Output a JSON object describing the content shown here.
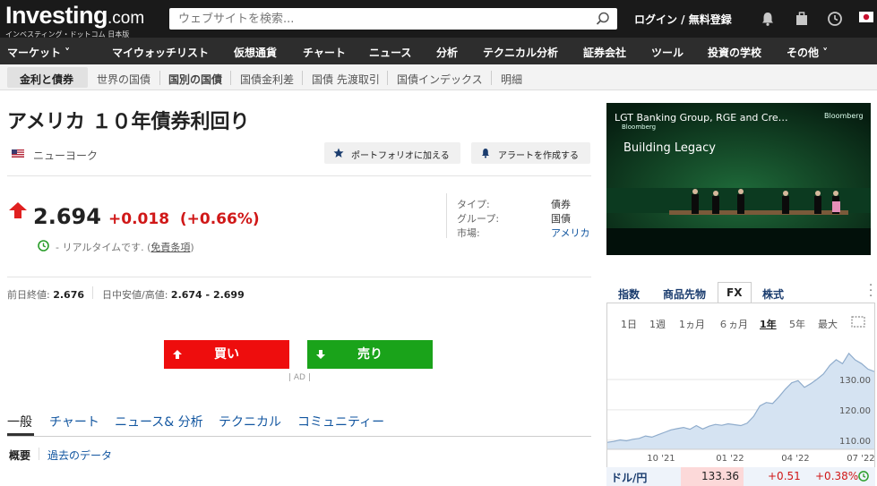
{
  "header": {
    "logo_main": "Investing",
    "logo_domain": ".com",
    "logo_sub": "インベスティング・ドットコム 日本版",
    "search_placeholder": "ウェブサイトを検索...",
    "login": "ログイン / 無料登録"
  },
  "nav": [
    {
      "label": "マーケット ˅"
    },
    {
      "label": "マイウォッチリスト"
    },
    {
      "label": "仮想通貨"
    },
    {
      "label": "チャート"
    },
    {
      "label": "ニュース"
    },
    {
      "label": "分析"
    },
    {
      "label": "テクニカル分析"
    },
    {
      "label": "証券会社"
    },
    {
      "label": "ツール"
    },
    {
      "label": "投資の学校"
    },
    {
      "label": "その他 ˅"
    }
  ],
  "subnav": [
    {
      "label": "金利と債券"
    },
    {
      "label": "世界の国債"
    },
    {
      "label": "国別の国債"
    },
    {
      "label": "国債金利差"
    },
    {
      "label": "国債 先渡取引"
    },
    {
      "label": "国債インデックス"
    },
    {
      "label": "明細"
    }
  ],
  "instrument": {
    "title": "アメリカ １０年債券利回り",
    "location": "ニューヨーク",
    "portfolio_btn": "ポートフォリオに加える",
    "alert_btn": "アラートを作成する",
    "price": "2.694",
    "change": "+0.018",
    "change_pct": "(+0.66%)",
    "realtime_text": "- リアルタイムです. (",
    "realtime_link": "免責条項",
    "realtime_end": ")",
    "info": [
      {
        "label": "タイプ:",
        "value": "債券"
      },
      {
        "label": "グループ:",
        "value": "国債"
      },
      {
        "label": "市場:",
        "value": "アメリカ"
      }
    ],
    "prev_close_label": "前日終値:",
    "prev_close": "2.676",
    "day_range_label": "日中安値/高値:",
    "day_range": "2.674 - 2.699",
    "buy": "買い",
    "sell": "売り",
    "ad": "| AD |"
  },
  "tabs": [
    {
      "label": "一般"
    },
    {
      "label": "チャート"
    },
    {
      "label": "ニュース& 分析"
    },
    {
      "label": "テクニカル"
    },
    {
      "label": "コミュニティー"
    }
  ],
  "subtabs": [
    {
      "label": "概要"
    },
    {
      "label": "過去のデータ"
    }
  ],
  "video": {
    "title": "LGT Banking Group, RGE and Cre…",
    "bloomberg_1": "Bloomberg",
    "bloomberg_2": "Bloomberg",
    "subtitle": "Building Legacy"
  },
  "market_widget": {
    "tabs": [
      "指数",
      "商品先物",
      "FX",
      "株式"
    ],
    "periods": [
      "1日",
      "1週",
      "1ヵ月",
      "６ヵ月",
      "1年",
      "5年",
      "最大"
    ],
    "active_period": "1年",
    "quote_name": "ドル/円",
    "quote_price": "133.36",
    "quote_change": "+0.51",
    "quote_change_pct": "+0.38%"
  },
  "chart_data": {
    "type": "area",
    "x_ticks": [
      "10 '21",
      "01 '22",
      "04 '22",
      "07 '22"
    ],
    "y_ticks": [
      110.0,
      120.0,
      130.0
    ],
    "ylim": [
      107,
      140
    ],
    "series": [
      {
        "values": [
          109.3,
          109.6,
          110.1,
          109.8,
          110.3,
          110.6,
          111.4,
          111.0,
          111.8,
          112.6,
          113.4,
          113.8,
          114.2,
          113.6,
          114.8,
          113.7,
          114.6,
          115.2,
          114.9,
          115.4,
          115.1,
          114.8,
          115.6,
          117.8,
          121.3,
          122.4,
          122.1,
          124.3,
          126.8,
          128.9,
          129.6,
          127.4,
          128.6,
          130.1,
          131.8,
          134.6,
          136.5,
          135.2,
          138.6,
          136.4,
          135.2,
          133.4,
          132.6
        ]
      }
    ]
  }
}
